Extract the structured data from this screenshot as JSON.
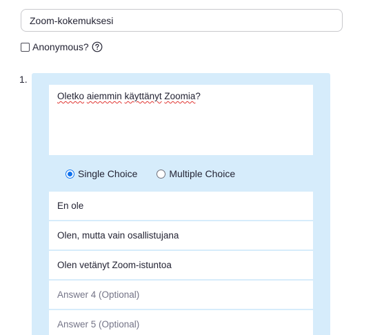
{
  "poll": {
    "title_value": "Zoom-kokemuksesi",
    "anonymous_label": "Anonymous?",
    "anonymous_checked": false
  },
  "question": {
    "number": "1.",
    "text_parts": [
      "Oletko",
      " ",
      "aiemmin",
      " ",
      "käyttänyt",
      " ",
      "Zoomia",
      "?"
    ],
    "choice_types": [
      {
        "label": "Single Choice",
        "selected": true
      },
      {
        "label": "Multiple Choice",
        "selected": false
      }
    ],
    "answers": [
      {
        "text": "En ole",
        "placeholder": false
      },
      {
        "text": "Olen, mutta vain osallistujana",
        "placeholder": false
      },
      {
        "text": "Olen vetänyt Zoom-istuntoa",
        "placeholder": false
      },
      {
        "text": "Answer 4 (Optional)",
        "placeholder": true
      },
      {
        "text": "Answer 5 (Optional)",
        "placeholder": true
      }
    ]
  },
  "colors": {
    "panel_bg": "#d6ecfb",
    "accent": "#0e72ed",
    "spellcheck": "#e0332f"
  },
  "icons": {
    "help": "question-circle-icon"
  }
}
